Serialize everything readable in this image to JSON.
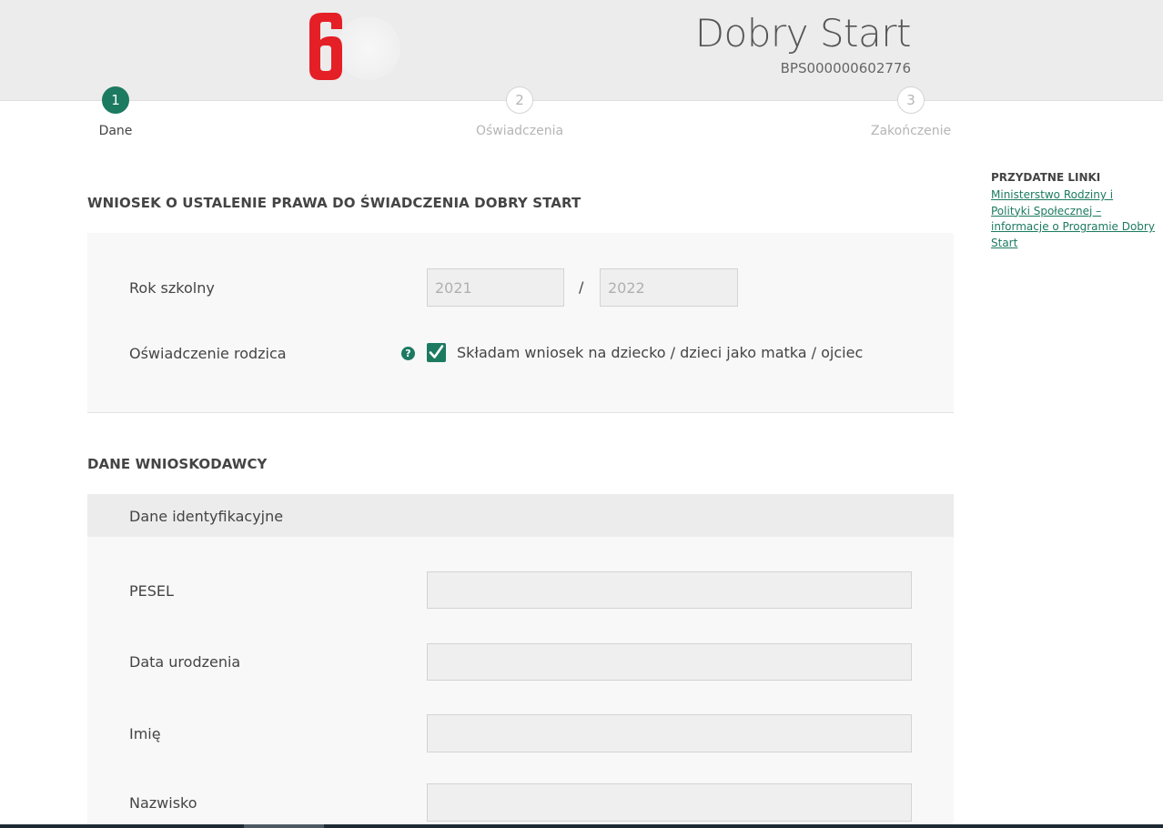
{
  "header": {
    "logo_glyph": "6",
    "title": "Dobry Start",
    "application_number": "BPS000000602776",
    "logo_color": "#e41f26",
    "background": "#ececec"
  },
  "steps": [
    {
      "number": "1",
      "label": "Dane",
      "state": "active"
    },
    {
      "number": "2",
      "label": "Oświadczenia",
      "state": "inactive"
    },
    {
      "number": "3",
      "label": "Zakończenie",
      "state": "inactive"
    }
  ],
  "form": {
    "section_title": "WNIOSEK O USTALENIE PRAWA DO ŚWIADCZENIA DOBRY START",
    "school_year": {
      "label": "Rok szkolny",
      "from": "2021",
      "separator": "/",
      "to": "2022"
    },
    "parent_declaration": {
      "label": "Oświadczenie rodzica",
      "help_glyph": "?",
      "checked": true,
      "checkbox_label": "Składam wniosek na dziecko / dzieci jako matka / ojciec"
    }
  },
  "applicant": {
    "section_title": "DANE WNIOSKODAWCY",
    "subsection_title": "Dane identyfikacyjne",
    "fields": {
      "pesel": {
        "label": "PESEL",
        "value": ""
      },
      "birth_date": {
        "label": "Data urodzenia",
        "value": ""
      },
      "first_name": {
        "label": "Imię",
        "value": ""
      },
      "last_name": {
        "label": "Nazwisko",
        "value": ""
      }
    }
  },
  "sidebar": {
    "title": "PRZYDATNE LINKI",
    "link_text": "Ministerstwo Rodziny i  Polityki Społecznej – informacje o Programie Dobry Start"
  },
  "colors": {
    "accent": "#1c7a61",
    "brand_red": "#e41f26"
  }
}
